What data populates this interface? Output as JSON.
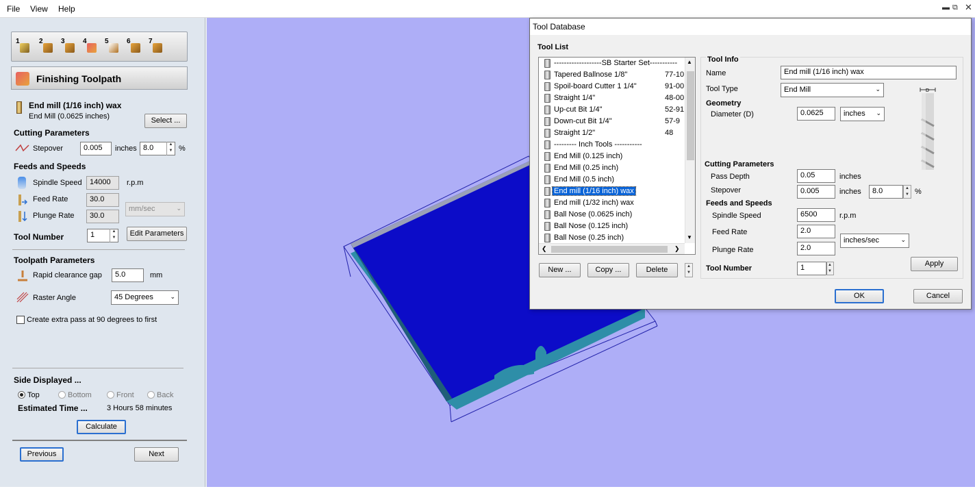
{
  "menu": {
    "file": "File",
    "view": "View",
    "help": "Help"
  },
  "left": {
    "steps": [
      "1",
      "2",
      "3",
      "4",
      "5",
      "6",
      "7"
    ],
    "title": "Finishing Toolpath",
    "tool_name": "End mill (1/16 inch) wax",
    "tool_desc": "End Mill (0.0625 inches)",
    "select_label": "Select ...",
    "cutting_params": "Cutting Parameters",
    "stepover_label": "Stepover",
    "stepover_value": "0.005",
    "stepover_unit": "inches",
    "stepover_pct": "8.0",
    "pct_sign": "%",
    "feeds_speeds": "Feeds and Speeds",
    "spindle_label": "Spindle Speed",
    "spindle_value": "14000",
    "spindle_unit": "r.p.m",
    "feed_label": "Feed Rate",
    "feed_value": "30.0",
    "plunge_label": "Plunge Rate",
    "plunge_value": "30.0",
    "rate_unit": "mm/sec",
    "tool_number_label": "Tool Number",
    "tool_number_value": "1",
    "edit_params": "Edit Parameters",
    "toolpath_params": "Toolpath Parameters",
    "rapid_label": "Rapid clearance gap",
    "rapid_value": "5.0",
    "rapid_unit": "mm",
    "raster_label": "Raster Angle",
    "raster_value": "45 Degrees",
    "extra_pass": "Create extra pass at 90 degrees to first",
    "side_displayed": "Side Displayed ...",
    "sides": {
      "top": "Top",
      "bottom": "Bottom",
      "front": "Front",
      "back": "Back"
    },
    "est_time_label": "Estimated Time ...",
    "est_time_value": "3 Hours 58 minutes",
    "calculate": "Calculate",
    "previous": "Previous",
    "next": "Next"
  },
  "dialog": {
    "title": "Tool Database",
    "tool_list_label": "Tool List",
    "tools": [
      {
        "name": "-------------------SB Starter Set-----------",
        "code": ""
      },
      {
        "name": "Tapered Ballnose    1/8\"",
        "code": "77-10"
      },
      {
        "name": "Spoil-board Cutter   1 1/4\"",
        "code": "91-00"
      },
      {
        "name": "Straight 1/4\"",
        "code": "48-00"
      },
      {
        "name": "Up-cut Bit 1/4\"",
        "code": "52-91"
      },
      {
        "name": "Down-cut Bit 1/4\"",
        "code": "57-9"
      },
      {
        "name": "Straight 1/2\"",
        "code": "48"
      },
      {
        "name": "--------- Inch Tools -----------",
        "code": ""
      },
      {
        "name": "End Mill (0.125 inch)",
        "code": ""
      },
      {
        "name": "End Mill (0.25 inch)",
        "code": ""
      },
      {
        "name": "End Mill (0.5 inch)",
        "code": ""
      },
      {
        "name": "End mill (1/16 inch) wax",
        "code": ""
      },
      {
        "name": "End mill (1/32 inch) wax",
        "code": ""
      },
      {
        "name": "Ball Nose (0.0625 inch)",
        "code": ""
      },
      {
        "name": "Ball Nose (0.125 inch)",
        "code": ""
      },
      {
        "name": "Ball Nose (0.25 inch)",
        "code": ""
      }
    ],
    "selected_index": 11,
    "new_btn": "New ...",
    "copy_btn": "Copy ...",
    "delete_btn": "Delete",
    "tool_info": "Tool Info",
    "name_label": "Name",
    "name_value": "End mill (1/16 inch) wax",
    "tool_type_label": "Tool Type",
    "tool_type_value": "End Mill",
    "geometry": "Geometry",
    "diameter_label": "Diameter (D)",
    "diameter_value": "0.0625",
    "diameter_unit": "inches",
    "cutting_params": "Cutting Parameters",
    "pass_depth_label": "Pass Depth",
    "pass_depth_value": "0.05",
    "pass_depth_unit": "inches",
    "stepover_label": "Stepover",
    "stepover_value": "0.005",
    "stepover_unit": "inches",
    "stepover_pct": "8.0",
    "pct_sign": "%",
    "feeds_speeds": "Feeds and Speeds",
    "spindle_label": "Spindle Speed",
    "spindle_value": "6500",
    "spindle_unit": "r.p.m",
    "feed_label": "Feed Rate",
    "feed_value": "2.0",
    "plunge_label": "Plunge Rate",
    "plunge_value": "2.0",
    "rate_unit": "inches/sec",
    "tool_number_label": "Tool Number",
    "tool_number_value": "1",
    "apply": "Apply",
    "ok": "OK",
    "cancel": "Cancel",
    "diagram_label": "D"
  },
  "colors": {
    "viewport": "#aeaef7",
    "model_top": "#0c0cc8",
    "model_side": "#2e8ea8",
    "selection": "#0a64d8"
  }
}
